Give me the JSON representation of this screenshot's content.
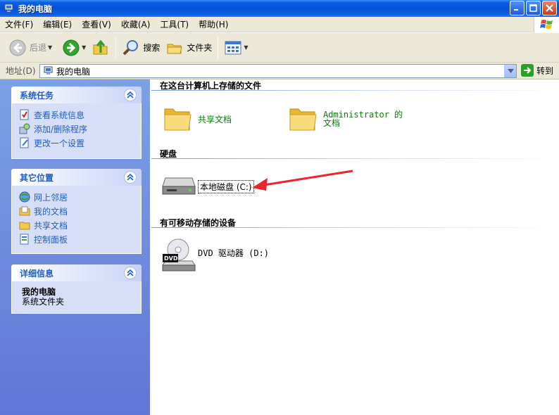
{
  "window": {
    "title": "我的电脑",
    "icons": {
      "app": "computer-icon"
    }
  },
  "menu": {
    "items": [
      "文件(F)",
      "编辑(E)",
      "查看(V)",
      "收藏(A)",
      "工具(T)",
      "帮助(H)"
    ]
  },
  "toolbar": {
    "back_label": "后退",
    "search_label": "搜索",
    "folders_label": "文件夹"
  },
  "address": {
    "label": "地址(D)",
    "value": "我的电脑",
    "go_label": "转到"
  },
  "taskpane": {
    "system_tasks": {
      "title": "系统任务",
      "items": [
        {
          "label": "查看系统信息",
          "icon": "system-info-icon"
        },
        {
          "label": "添加/删除程序",
          "icon": "add-remove-programs-icon"
        },
        {
          "label": "更改一个设置",
          "icon": "change-setting-icon"
        }
      ]
    },
    "other_places": {
      "title": "其它位置",
      "items": [
        {
          "label": "网上邻居",
          "icon": "network-icon"
        },
        {
          "label": "我的文档",
          "icon": "my-documents-icon"
        },
        {
          "label": "共享文档",
          "icon": "shared-folder-icon"
        },
        {
          "label": "控制面板",
          "icon": "control-panel-icon"
        }
      ]
    },
    "details": {
      "title": "详细信息",
      "name": "我的电脑",
      "type": "系统文件夹"
    }
  },
  "content": {
    "groups": {
      "files": {
        "title": "在这台计算机上存储的文件",
        "items": [
          {
            "label": "共享文档"
          },
          {
            "label": "Administrator 的文档"
          }
        ]
      },
      "hard_drives": {
        "title": "硬盘",
        "items": [
          {
            "label": "本地磁盘 (C:)"
          }
        ]
      },
      "removable": {
        "title": "有可移动存储的设备",
        "items": [
          {
            "label": "DVD 驱动器 (D:)",
            "badge": "DVD"
          }
        ]
      }
    }
  },
  "colors": {
    "annotation_arrow": "#e8262b",
    "title_bar": "#0553d6",
    "taskpane_link": "#215dc6",
    "folder_label": "#0b7a0b"
  }
}
